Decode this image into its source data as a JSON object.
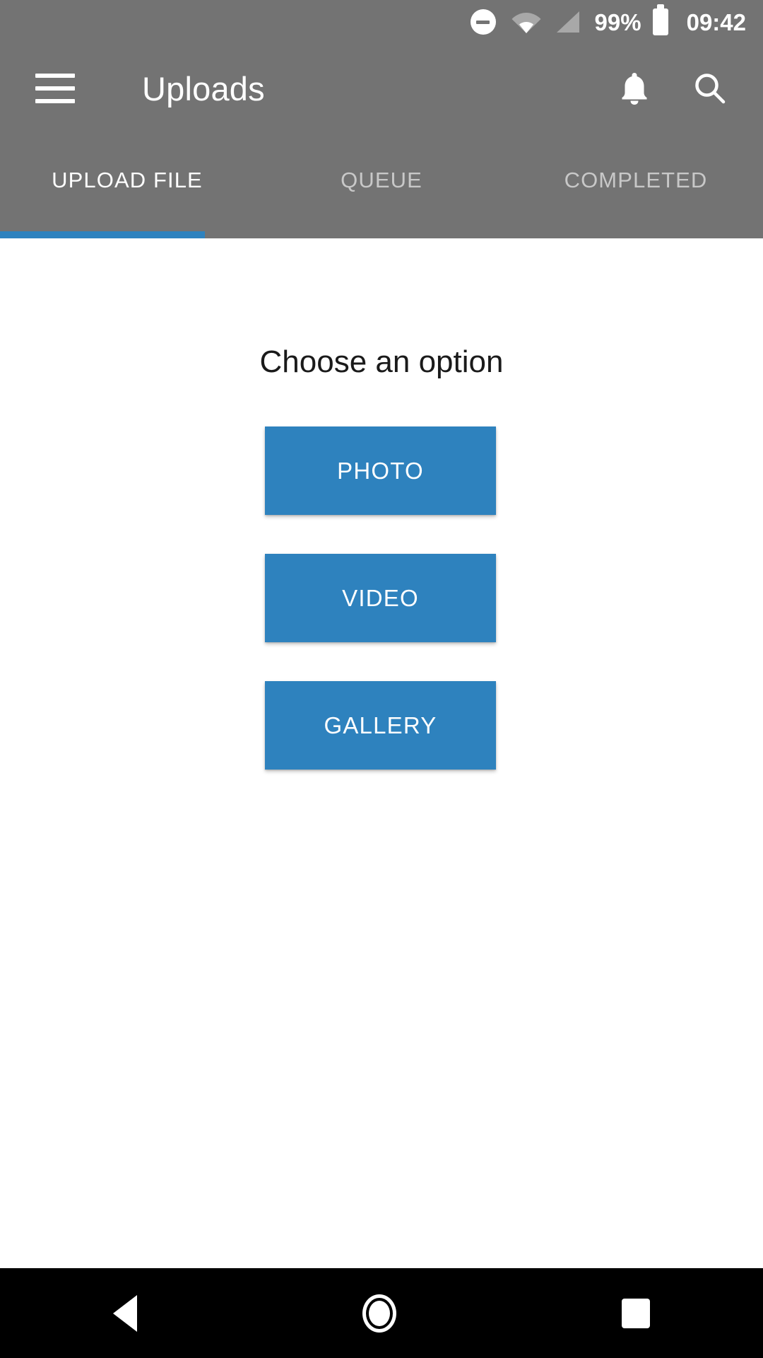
{
  "status_bar": {
    "dnd_icon": "do-not-disturb-icon",
    "wifi_icon": "wifi-icon",
    "signal_icon": "cell-signal-icon",
    "battery_percent": "99%",
    "battery_icon": "battery-full-icon",
    "clock": "09:42"
  },
  "app_bar": {
    "menu_icon": "hamburger-menu-icon",
    "title": "Uploads",
    "notification_icon": "bell-icon",
    "search_icon": "search-icon"
  },
  "tabs": {
    "active_index": 0,
    "indicator_color": "#2e82be",
    "items": [
      {
        "label": "UPLOAD FILE"
      },
      {
        "label": "QUEUE"
      },
      {
        "label": "COMPLETED"
      }
    ]
  },
  "content": {
    "heading": "Choose an option",
    "button_color": "#2e82be",
    "buttons": [
      {
        "label": "PHOTO"
      },
      {
        "label": "VIDEO"
      },
      {
        "label": "GALLERY"
      }
    ]
  },
  "nav_bar": {
    "back_icon": "back-triangle-icon",
    "home_icon": "home-circle-icon",
    "recents_icon": "recents-square-icon"
  }
}
